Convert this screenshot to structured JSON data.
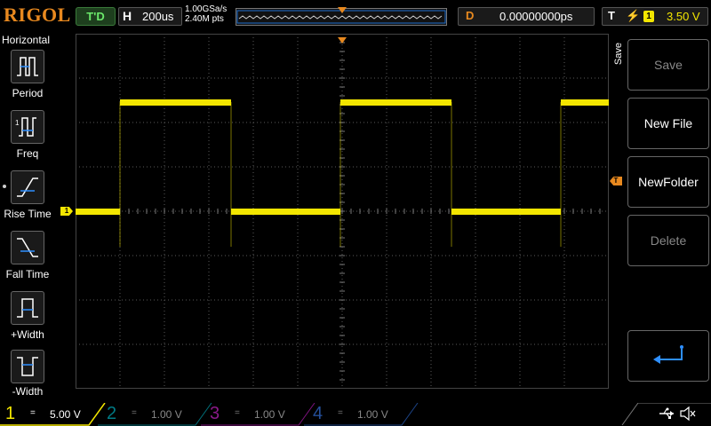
{
  "brand": "RIGOL",
  "status": {
    "run_state": "T'D",
    "horizontal": {
      "label": "H",
      "timebase": "200us"
    },
    "sample_rate": "1.00GSa/s",
    "memory_depth": "2.40M pts",
    "delay": {
      "label": "D",
      "value": "0.00000000ps"
    },
    "trigger": {
      "label": "T",
      "source": "1",
      "level": "3.50 V"
    }
  },
  "left_menu": {
    "title": "Horizontal",
    "items": [
      {
        "label": "Period",
        "icon": "period-icon"
      },
      {
        "label": "Freq",
        "icon": "freq-icon"
      },
      {
        "label": "Rise Time",
        "icon": "rise-time-icon"
      },
      {
        "label": "Fall Time",
        "icon": "fall-time-icon"
      },
      {
        "label": "+Width",
        "icon": "positive-width-icon"
      },
      {
        "label": "-Width",
        "icon": "negative-width-icon"
      }
    ]
  },
  "right_menu": {
    "title": "Save",
    "keys": [
      {
        "label": "Save",
        "enabled": false
      },
      {
        "label": "New File",
        "enabled": true
      },
      {
        "label": "NewFolder",
        "enabled": true
      },
      {
        "label": "Delete",
        "enabled": false
      }
    ],
    "back_icon": "return-arrow-icon"
  },
  "channel_marker": "1",
  "trigger_marker": "T",
  "channels": [
    {
      "num": "1",
      "coupling": "=",
      "scale": "5.00 V",
      "color": "#f3e600",
      "active": true
    },
    {
      "num": "2",
      "coupling": "=",
      "scale": "1.00 V",
      "color": "#00b8c8",
      "active": false
    },
    {
      "num": "3",
      "coupling": "=",
      "scale": "1.00 V",
      "color": "#d020d0",
      "active": false
    },
    {
      "num": "4",
      "coupling": "=",
      "scale": "1.00 V",
      "color": "#2f6fe0",
      "active": false
    }
  ],
  "colors": {
    "ch1": "#f3e600",
    "accent": "#e8891f",
    "grid": "#5a5a5a"
  },
  "system_icons": [
    "usb-icon",
    "speaker-muted-icon"
  ]
}
